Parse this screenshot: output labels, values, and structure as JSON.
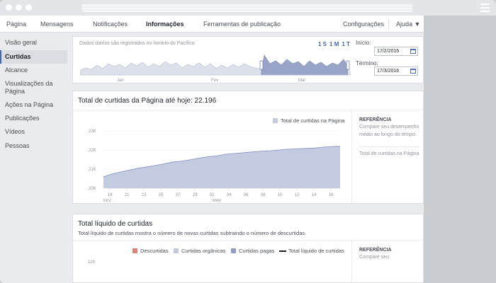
{
  "colors": {
    "accent": "#4267b2",
    "area_fill": "#c3cbe0",
    "area_stroke": "#8592c0",
    "descurtidas": "#e0807a",
    "organicas": "#c3cbe0",
    "pagas": "#8e9cc6",
    "total_line": "#1d2129"
  },
  "topnav": {
    "items": [
      "Página",
      "Mensagens",
      "Notificações",
      "Informações",
      "Ferramentas de publicação"
    ],
    "active": "Informações",
    "right": [
      "Configurações",
      "Ajuda"
    ]
  },
  "sidebar": {
    "items": [
      "Visão geral",
      "Curtidas",
      "Alcance",
      "Visualizações da Página",
      "Ações na Página",
      "Publicações",
      "Vídeos",
      "Pessoas"
    ],
    "selected": "Curtidas"
  },
  "overview": {
    "note": "Dados diários são registrados no horário do Pacífico",
    "ranges": [
      "1 S",
      "1 M",
      "1 T"
    ],
    "start_label": "Início:",
    "start_value": "17/2/2016",
    "end_label": "Término:",
    "end_value": "17/3/2016",
    "month_labels": [
      "Jan",
      "Fev",
      "Mar"
    ]
  },
  "likes_card": {
    "title": "Total de curtidas da Página até hoje: 22.196",
    "legend": "Total de curtidas na Página",
    "reference_title": "REFERÊNCIA",
    "reference_text": "Compare seu desempenho médio ao longo do tempo.",
    "reference_link": "Total de curtidas na Página"
  },
  "net_card": {
    "title": "Total líquido de curtidas",
    "subtitle": "Total líquido de curtidas mostra o número de novas curtidas subtraindo o número de descurtidas.",
    "legend": [
      "Descurtidas",
      "Curtidas orgânicas",
      "Curtidas pagas",
      "Total líquido de curtidas"
    ],
    "reference_title": "REFERÊNCIA",
    "reference_text": "Compare seu",
    "y_top_label": "120"
  },
  "chart_data": {
    "type": "area",
    "title": "Total de curtidas da Página até hoje: 22.196",
    "series": [
      {
        "name": "Total de curtidas na Página",
        "values": [
          20600,
          20750,
          20850,
          20950,
          21050,
          21120,
          21200,
          21280,
          21380,
          21420,
          21500,
          21580,
          21650,
          21700,
          21780,
          21820,
          21860,
          21900,
          21940,
          21960,
          22000,
          22040,
          22060,
          22080,
          22100,
          22150,
          22180,
          22196
        ]
      }
    ],
    "x_tick_labels": [
      "19",
      "21",
      "23",
      "25",
      "27",
      "29",
      "02",
      "04",
      "06",
      "08",
      "10",
      "12",
      "14",
      "16"
    ],
    "x_month_labels": [
      "FEV",
      "MAR"
    ],
    "y_tick_labels": [
      "20K",
      "21K",
      "22K",
      "23K"
    ],
    "ylim": [
      20000,
      23000
    ],
    "grid": true,
    "legend_position": "top-right"
  }
}
